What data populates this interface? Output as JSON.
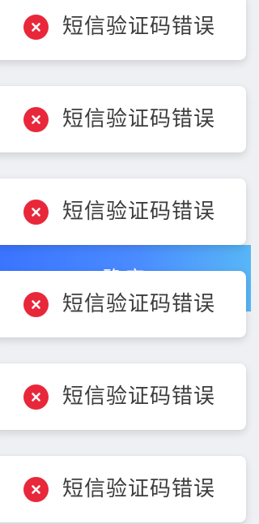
{
  "confirm_button": {
    "label": "确定"
  },
  "toasts": [
    {
      "message": "短信验证码错误",
      "icon": "error-x-icon"
    },
    {
      "message": "短信验证码错误",
      "icon": "error-x-icon"
    },
    {
      "message": "短信验证码错误",
      "icon": "error-x-icon"
    },
    {
      "message": "短信验证码错误",
      "icon": "error-x-icon"
    },
    {
      "message": "短信验证码错误",
      "icon": "error-x-icon"
    },
    {
      "message": "短信验证码错误",
      "icon": "error-x-icon"
    }
  ],
  "colors": {
    "error_icon": "#e8283a",
    "button_gradient_start": "#3b74ff",
    "button_gradient_end": "#58b6f6"
  }
}
